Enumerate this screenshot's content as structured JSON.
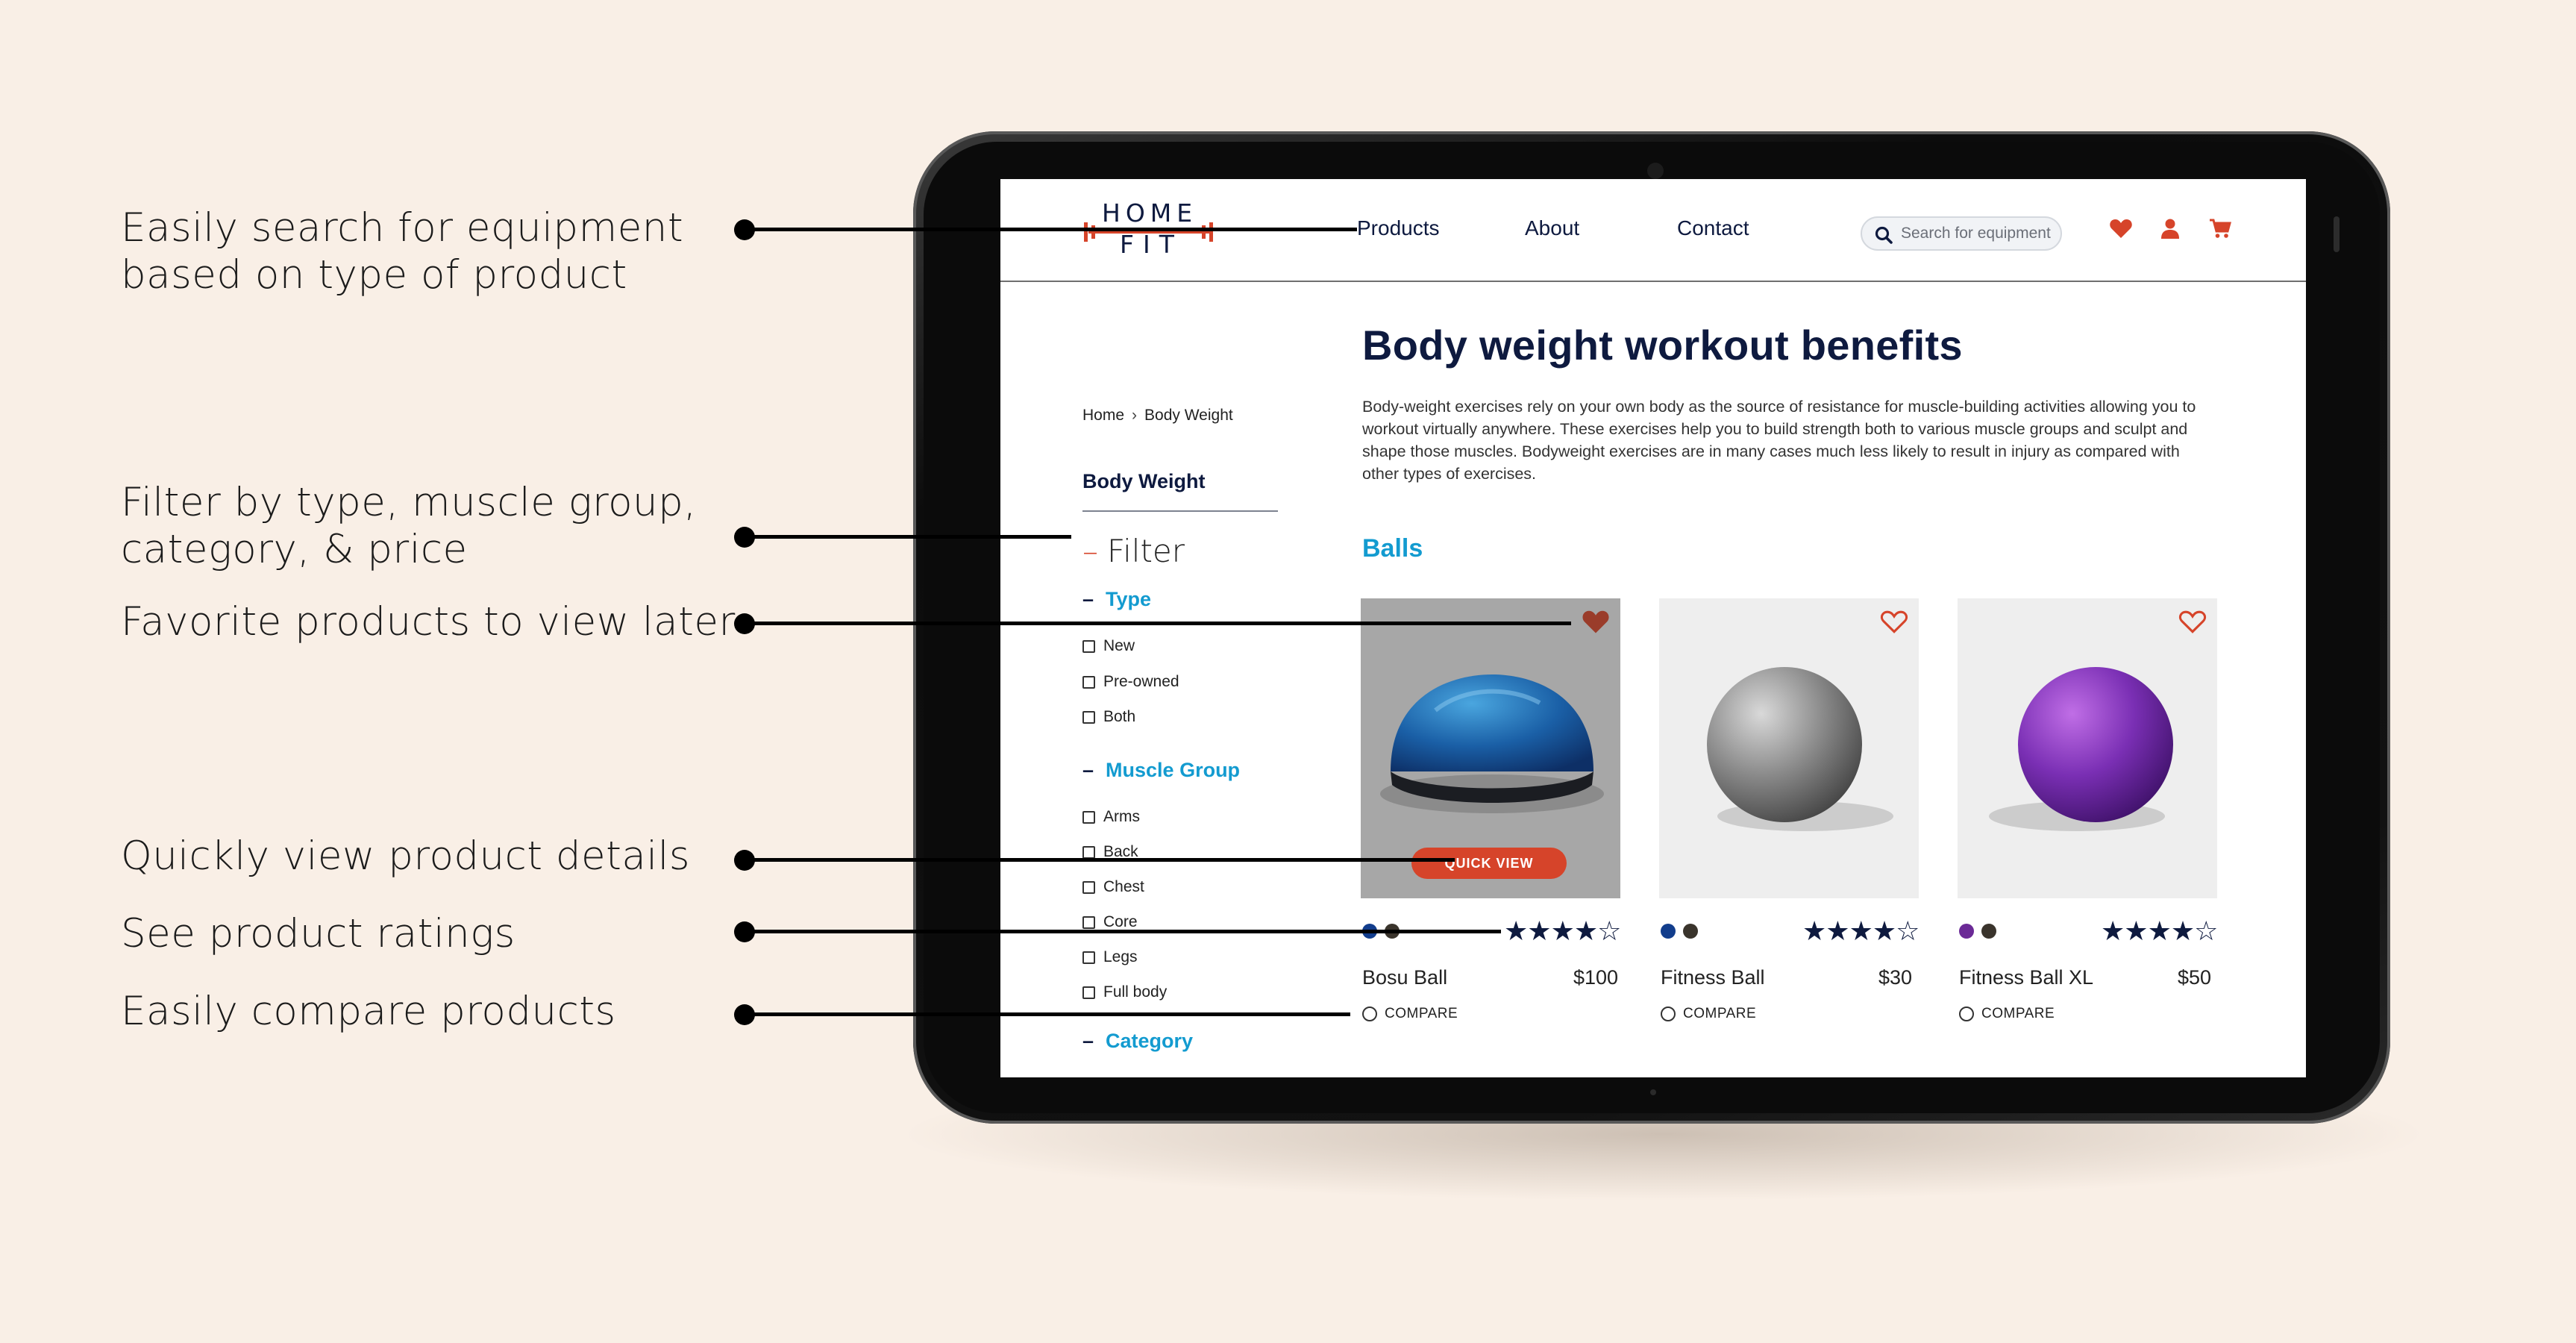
{
  "annotations": [
    {
      "text": "Easily search for equipment\nbased on type of product"
    },
    {
      "text": "Filter by type, muscle group,\ncategory, & price"
    },
    {
      "text": "Favorite products to view later"
    },
    {
      "text": "Quickly view product details"
    },
    {
      "text": "See product ratings"
    },
    {
      "text": "Easily compare products"
    }
  ],
  "logo": {
    "line1": "HOME",
    "line2": "FIT"
  },
  "nav": {
    "products": "Products",
    "about": "About",
    "contact": "Contact"
  },
  "search": {
    "placeholder": "Search for equipment",
    "value": ""
  },
  "breadcrumb": {
    "home": "Home",
    "sep": "›",
    "current": "Body Weight"
  },
  "category_title": "Body Weight",
  "filter": {
    "title": "Filter",
    "groups": [
      {
        "label": "Type",
        "options": [
          "New",
          "Pre-owned",
          "Both"
        ]
      },
      {
        "label": "Muscle Group",
        "options": [
          "Arms",
          "Back",
          "Chest",
          "Core",
          "Legs",
          "Full body"
        ]
      },
      {
        "label": "Category",
        "options": []
      }
    ]
  },
  "main": {
    "title": "Body weight workout benefits",
    "description": "Body-weight exercises rely on your own body as the source of resistance for muscle-building activities allowing you to workout virtually anywhere. These exercises help you to build strength both to various muscle groups and sculpt and shape those muscles. Bodyweight exercises are in many cases much less likely to result in injury as compared with other types of exercises.",
    "section": "Balls"
  },
  "products": [
    {
      "name": "Bosu Ball",
      "price": "$100",
      "rating": 4,
      "rating_max": 5,
      "favorited": true,
      "swatches": [
        "#123d8c",
        "#3a342c"
      ],
      "quick_view": "QUICK VIEW",
      "compare": "COMPARE"
    },
    {
      "name": "Fitness Ball",
      "price": "$30",
      "rating": 4,
      "rating_max": 5,
      "favorited": false,
      "swatches": [
        "#123d8c",
        "#3a342c"
      ],
      "compare": "COMPARE"
    },
    {
      "name": "Fitness Ball XL",
      "price": "$50",
      "rating": 4,
      "rating_max": 5,
      "favorited": false,
      "swatches": [
        "#6b2a96",
        "#3a342c"
      ],
      "compare": "COMPARE"
    }
  ],
  "colors": {
    "accent": "#d6442a",
    "link": "#139bd0",
    "navy": "#0e1a3f",
    "background": "#f9efe6"
  }
}
